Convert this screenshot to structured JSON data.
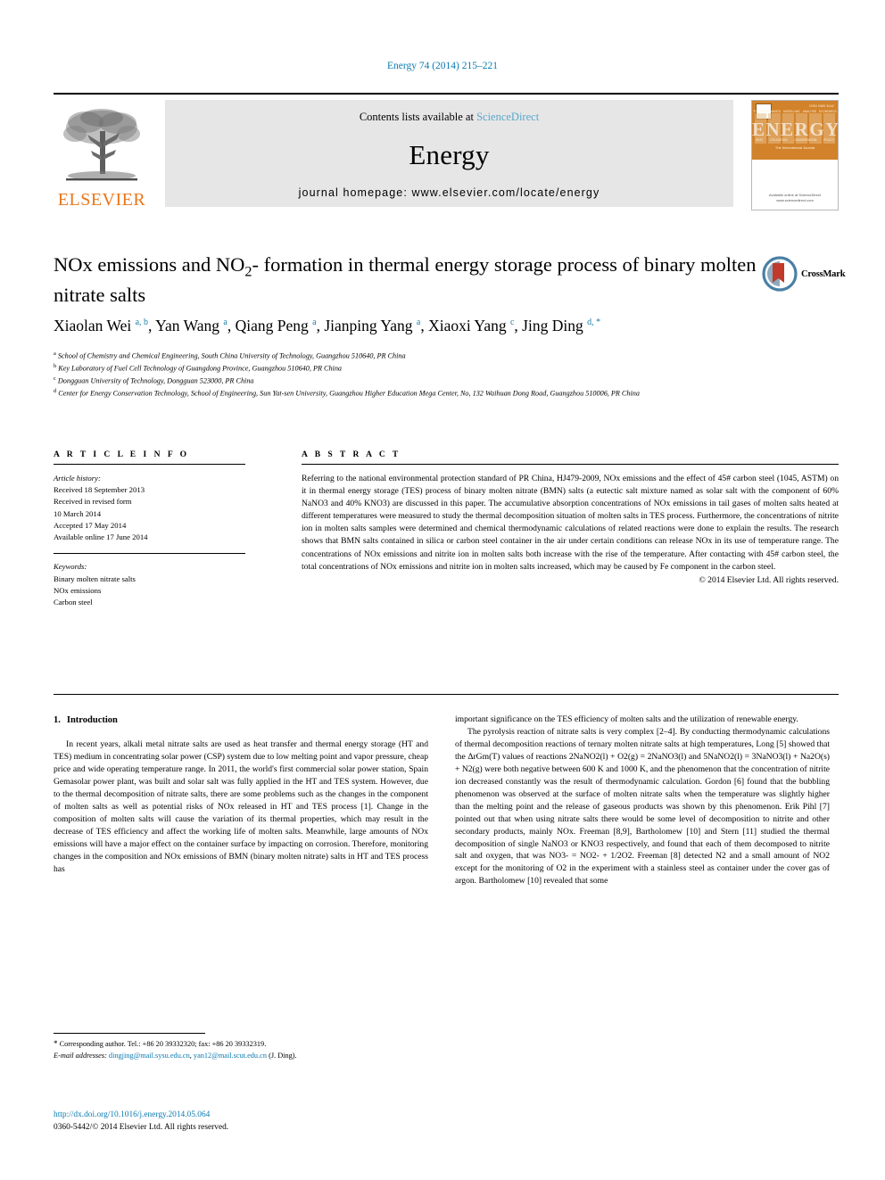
{
  "running_head": "Energy 74 (2014) 215–221",
  "masthead": {
    "contents_prefix": "Contents lists available at ",
    "sciencedirect": "ScienceDirect",
    "journal_name": "Energy",
    "homepage": "journal homepage: www.elsevier.com/locate/energy",
    "publisher_logo_text": "ELSEVIER",
    "cover": {
      "title": "ENERGY",
      "issn": "ISSN 0360-5442",
      "subtitle": "The International Journal",
      "labels_top": [
        "THERMODYNAMICS",
        "MODELLING",
        "ANALYSIS",
        "ECONOMICS"
      ],
      "labels_bottom": [
        "HEAT",
        "UTILIZATION",
        "CONSERVATION",
        "POLICY"
      ],
      "publisher": "Available online at\nScienceDirect\nwww.sciencedirect.com"
    }
  },
  "article": {
    "title": "NOx emissions and NO2- formation in thermal energy storage process of binary molten nitrate salts",
    "crossmark_label": "CrossMark",
    "authors": [
      {
        "name": "Xiaolan Wei",
        "marks": "a, b"
      },
      {
        "name": "Yan Wang",
        "marks": "a"
      },
      {
        "name": "Qiang Peng",
        "marks": "a"
      },
      {
        "name": "Jianping Yang",
        "marks": "a"
      },
      {
        "name": "Xiaoxi Yang",
        "marks": "c"
      },
      {
        "name": "Jing Ding",
        "marks": "d, *"
      }
    ],
    "affiliations": [
      {
        "mark": "a",
        "text": "School of Chemistry and Chemical Engineering, South China University of Technology, Guangzhou 510640, PR China"
      },
      {
        "mark": "b",
        "text": "Key Laboratory of Fuel Cell Technology of Guangdong Province, Guangzhou 510640, PR China"
      },
      {
        "mark": "c",
        "text": "Dongguan University of Technology, Dongguan 523000, PR China"
      },
      {
        "mark": "d",
        "text": "Center for Energy Conservation Technology, School of Engineering, Sun Yat-sen University, Guangzhou Higher Education Mega Center, No, 132 Waihuan Dong Road, Guangzhou 510006, PR China"
      }
    ]
  },
  "article_info": {
    "heading": "A R T I C L E   I N F O",
    "history_label": "Article history:",
    "history": [
      "Received 18 September 2013",
      "Received in revised form",
      "10 March 2014",
      "Accepted 17 May 2014",
      "Available online 17 June 2014"
    ],
    "keywords_label": "Keywords:",
    "keywords": [
      "Binary molten nitrate salts",
      "NOx emissions",
      "Carbon steel"
    ]
  },
  "abstract": {
    "heading": "A B S T R A C T",
    "text": "Referring to the national environmental protection standard of PR China, HJ479-2009, NOx emissions and the effect of 45# carbon steel (1045, ASTM) on it in thermal energy storage (TES) process of binary molten nitrate (BMN) salts (a eutectic salt mixture named as solar salt with the component of 60% NaNO3 and 40% KNO3) are discussed in this paper. The accumulative absorption concentrations of NOx emissions in tail gases of molten salts heated at different temperatures were measured to study the thermal decomposition situation of molten salts in TES process. Furthermore, the concentrations of nitrite ion in molten salts samples were determined and chemical thermodynamic calculations of related reactions were done to explain the results. The research shows that BMN salts contained in silica or carbon steel container in the air under certain conditions can release NOx in its use of temperature range. The concentrations of NOx emissions and nitrite ion in molten salts both increase with the rise of the temperature. After contacting with 45# carbon steel, the total concentrations of NOx emissions and nitrite ion in molten salts increased, which may be caused by Fe component in the carbon steel.",
    "copyright": "© 2014 Elsevier Ltd. All rights reserved."
  },
  "body": {
    "section_number": "1.",
    "section_title": "Introduction",
    "left_paragraph": "In recent years, alkali metal nitrate salts are used as heat transfer and thermal energy storage (HT and TES) medium in concentrating solar power (CSP) system due to low melting point and vapor pressure, cheap price and wide operating temperature range. In 2011, the world's first commercial solar power station, Spain Gemasolar power plant, was built and solar salt was fully applied in the HT and TES system. However, due to the thermal decomposition of nitrate salts, there are some problems such as the changes in the component of molten salts as well as potential risks of NOx released in HT and TES process [1]. Change in the composition of molten salts will cause the variation of its thermal properties, which may result in the decrease of TES efficiency and affect the working life of molten salts. Meanwhile, large amounts of NOx emissions will have a major effect on the container surface by impacting on corrosion. Therefore, monitoring changes in the composition and NOx emissions of BMN (binary molten nitrate) salts in HT and TES process has",
    "right_paragraph_1": "important significance on the TES efficiency of molten salts and the utilization of renewable energy.",
    "right_paragraph_2": "The pyrolysis reaction of nitrate salts is very complex [2–4]. By conducting thermodynamic calculations of thermal decomposition reactions of ternary molten nitrate salts at high temperatures, Long [5] showed that the ΔrGm(T) values of reactions 2NaNO2(l) + O2(g) = 2NaNO3(l) and 5NaNO2(l) = 3NaNO3(l) + Na2O(s) + N2(g) were both negative between 600 K and 1000 K, and the phenomenon that the concentration of nitrite ion decreased constantly was the result of thermodynamic calculation. Gordon [6] found that the bubbling phenomenon was observed at the surface of molten nitrate salts when the temperature was slightly higher than the melting point and the release of gaseous products was shown by this phenomenon. Erik Pihl [7] pointed out that when using nitrate salts there would be some level of decomposition to nitrite and other secondary products, mainly NOx. Freeman [8,9], Bartholomew [10] and Stern [11] studied the thermal decomposition of single NaNO3 or KNO3 respectively, and found that each of them decomposed to nitrite salt and oxygen, that was NO3- = NO2- + 1/2O2. Freeman [8] detected N2 and a small amount of NO2 except for the monitoring of O2 in the experiment with a stainless steel as container under the cover gas of argon. Bartholomew [10] revealed that some"
  },
  "footnote": {
    "corresponding": "Corresponding author. Tel.: +86 20 39332320; fax: +86 20 39332319.",
    "email_label": "E-mail addresses:",
    "email1": "dingjing@mail.sysu.edu.cn",
    "email2": "yan12@mail.scut.edu.cn",
    "email_suffix": "(J. Ding)."
  },
  "footer": {
    "doi": "http://dx.doi.org/10.1016/j.energy.2014.05.064",
    "issn_line": "0360-5442/© 2014 Elsevier Ltd. All rights reserved."
  },
  "colors": {
    "link_blue": "#0a7ab0",
    "sciencedirect_blue": "#5aa7cc",
    "elsevier_orange": "#e8761a",
    "cover_orange": "#d2822a"
  }
}
